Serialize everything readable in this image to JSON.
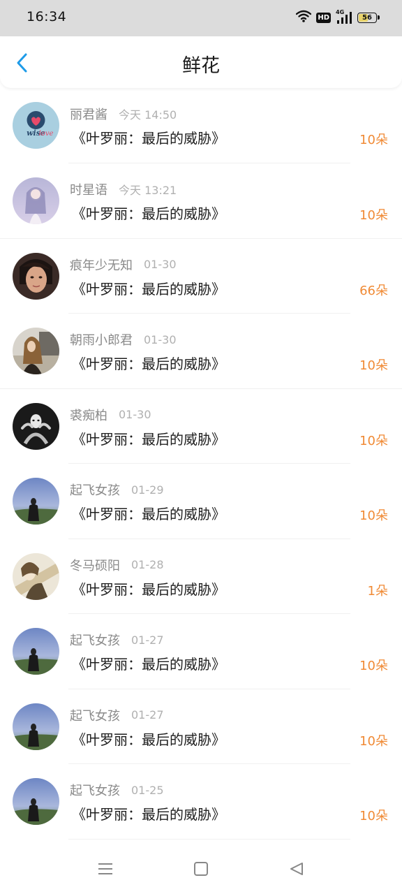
{
  "status_bar": {
    "time": "16:34",
    "network": "4G",
    "hd": "HD",
    "battery": "56",
    "battery_level": 0.56,
    "icons": [
      "wifi-icon",
      "hd-icon",
      "signal-4g-icon",
      "battery-icon"
    ]
  },
  "header": {
    "title": "鲜花",
    "back_icon": "chevron-left-icon",
    "accent_color": "#1e9be8"
  },
  "colors": {
    "flower_count": "#f08a35",
    "name": "#8a8a8a",
    "time": "#b0b0b0"
  },
  "items": [
    {
      "name": "丽君酱",
      "time": "今天 14:50",
      "book": "《叶罗丽：最后的威胁》",
      "count": "10朵",
      "avatar": "wiselove-logo"
    },
    {
      "name": "时星语",
      "time": "今天 13:21",
      "book": "《叶罗丽：最后的威胁》",
      "count": "10朵",
      "avatar": "anime-girl"
    },
    {
      "name": "痕年少无知",
      "time": "01-30",
      "book": "《叶罗丽：最后的威胁》",
      "count": "66朵",
      "avatar": "portrait-face"
    },
    {
      "name": "朝雨小郎君",
      "time": "01-30",
      "book": "《叶罗丽：最后的威胁》",
      "count": "10朵",
      "avatar": "girl-outdoor"
    },
    {
      "name": "裘痴柏",
      "time": "01-30",
      "book": "《叶罗丽：最后的威胁》",
      "count": "10朵",
      "avatar": "mask-figure"
    },
    {
      "name": "起飞女孩",
      "time": "01-29",
      "book": "《叶罗丽：最后的威胁》",
      "count": "10朵",
      "avatar": "girl-sky"
    },
    {
      "name": "冬马硕阳",
      "time": "01-28",
      "book": "《叶罗丽：最后的威胁》",
      "count": "1朵",
      "avatar": "anime-sketch"
    },
    {
      "name": "起飞女孩",
      "time": "01-27",
      "book": "《叶罗丽：最后的威胁》",
      "count": "10朵",
      "avatar": "girl-sky"
    },
    {
      "name": "起飞女孩",
      "time": "01-27",
      "book": "《叶罗丽：最后的威胁》",
      "count": "10朵",
      "avatar": "girl-sky"
    },
    {
      "name": "起飞女孩",
      "time": "01-25",
      "book": "《叶罗丽：最后的威胁》",
      "count": "10朵",
      "avatar": "girl-sky"
    }
  ],
  "nav_bar": {
    "icons": [
      "menu-icon",
      "home-square-icon",
      "back-triangle-icon"
    ]
  }
}
